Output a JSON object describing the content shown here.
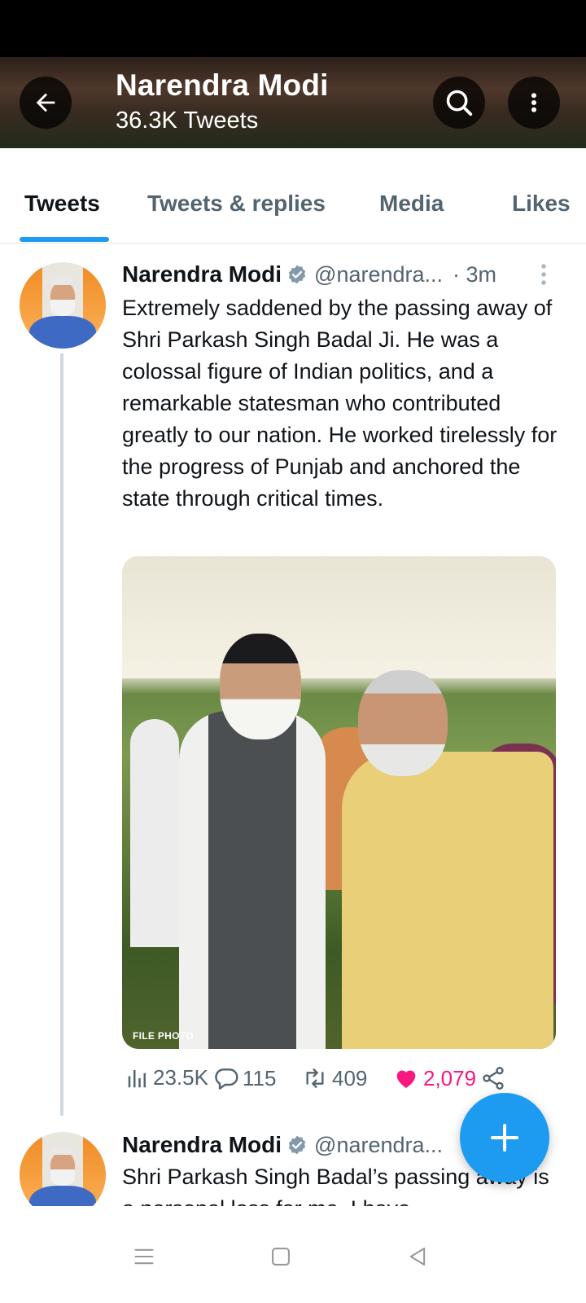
{
  "header": {
    "title": "Narendra Modi",
    "subtitle": "36.3K Tweets",
    "back_icon": "arrow-left-icon",
    "search_icon": "search-icon",
    "more_icon": "more-vertical-icon"
  },
  "tabs": [
    {
      "label": "Tweets",
      "active": true
    },
    {
      "label": "Tweets & replies",
      "active": false
    },
    {
      "label": "Media",
      "active": false
    },
    {
      "label": "Likes",
      "active": false
    }
  ],
  "tweets": [
    {
      "name": "Narendra Modi",
      "handle": "@narendra...",
      "time": "· 3m",
      "text": "Extremely saddened by the passing away of Shri Parkash Singh Badal Ji. He was a colossal figure of Indian politics, and a remarkable statesman who contributed greatly to our nation. He worked tirelessly for the progress of Punjab and anchored the state through critical times.",
      "photo_caption": "FILE PHOTO",
      "views": "23.5K",
      "replies": "115",
      "retweets": "409",
      "likes": "2,079"
    },
    {
      "name": "Narendra Modi",
      "handle": "@narendra...",
      "text": "Shri Parkash Singh Badal’s passing away is a personal loss for me. I have"
    }
  ],
  "colors": {
    "accent": "#1d9bf0",
    "like": "#f91880",
    "secondary_text": "#536471"
  }
}
